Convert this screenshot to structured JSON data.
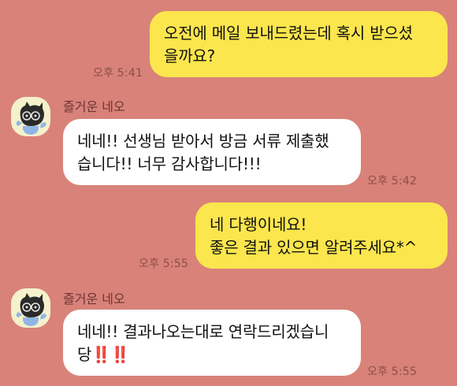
{
  "messages": [
    {
      "id": 1,
      "from": "me",
      "text": "오전에 메일 보내드렸는데 혹시 받으셨\n을까요?",
      "time": "오후 5:41"
    },
    {
      "id": 2,
      "from": "other",
      "sender": "즐거운 네오",
      "text": "네네!! 선생님 받아서 방금 서류 제출했\n습니다!! 너무 감사합니다!!!",
      "time": "오후 5:42"
    },
    {
      "id": 3,
      "from": "me",
      "text": "네 다행이네요!\n좋은 결과 있으면 알려주세요*^",
      "time": "오후 5:55"
    },
    {
      "id": 4,
      "from": "other",
      "sender": "즐거운 네오",
      "text_line1": "네네!! 결과나오는대로 연락드리겠습니",
      "text_line2": "당",
      "text_marks": "‼️‼️",
      "time": "오후 5:55"
    }
  ],
  "colors": {
    "background": "#D98279",
    "my_bubble": "#FBE64D",
    "other_bubble": "#FFFFFF"
  },
  "icons": {
    "avatar": "neo-character-avatar"
  }
}
